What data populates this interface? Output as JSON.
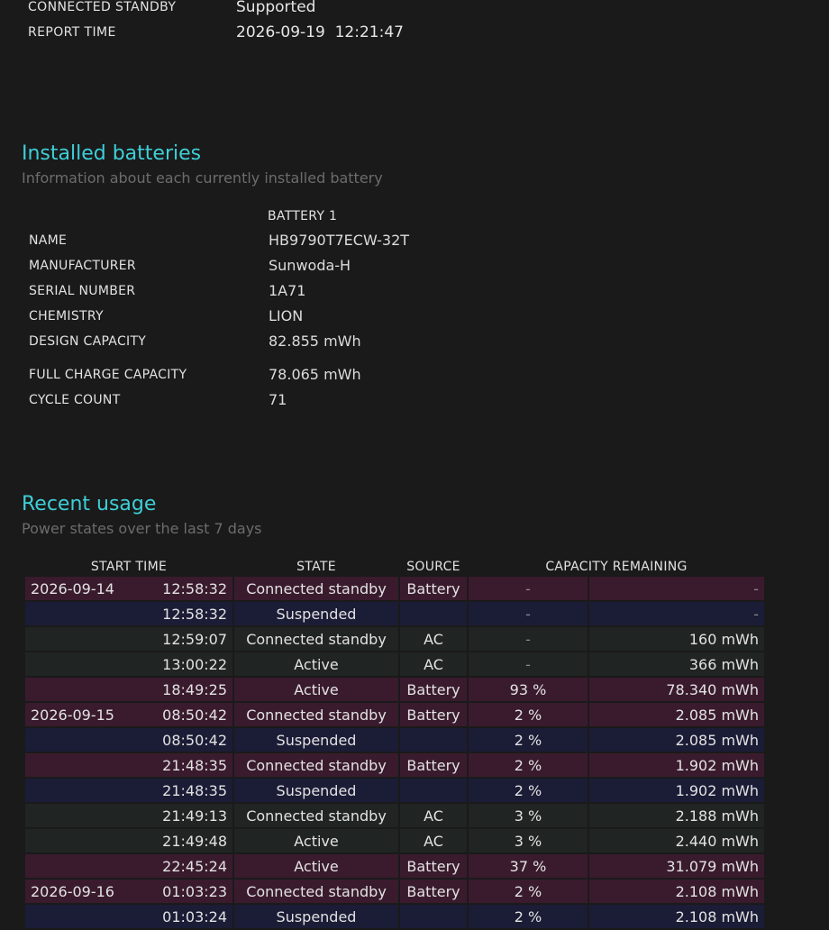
{
  "system": {
    "rows": [
      {
        "label": "CONNECTED STANDBY",
        "value": "Supported"
      },
      {
        "label": "REPORT TIME",
        "value": "2026-09-19  12:21:47"
      }
    ]
  },
  "installed": {
    "title": "Installed batteries",
    "subtitle": "Information about each currently installed battery",
    "column": "BATTERY 1",
    "rows": [
      {
        "label": "NAME",
        "value": "HB9790T7ECW-32T"
      },
      {
        "label": "MANUFACTURER",
        "value": "Sunwoda-H"
      },
      {
        "label": "SERIAL NUMBER",
        "value": "1A71"
      },
      {
        "label": "CHEMISTRY",
        "value": "LION"
      },
      {
        "label": "DESIGN CAPACITY",
        "value": "82.855 mWh"
      },
      {
        "label": "FULL CHARGE CAPACITY",
        "value": "78.065 mWh"
      },
      {
        "label": "CYCLE COUNT",
        "value": "71"
      }
    ]
  },
  "usage": {
    "title": "Recent usage",
    "subtitle": "Power states over the last 7 days",
    "headers": [
      "START TIME",
      "STATE",
      "SOURCE",
      "CAPACITY REMAINING"
    ],
    "rows": [
      {
        "date": "2026-09-14",
        "time": "12:58:32",
        "state": "Connected standby",
        "source": "Battery",
        "pct": "-",
        "mwh": "-",
        "kind": "battery"
      },
      {
        "date": "",
        "time": "12:58:32",
        "state": "Suspended",
        "source": "",
        "pct": "-",
        "mwh": "-",
        "kind": "suspended"
      },
      {
        "date": "",
        "time": "12:59:07",
        "state": "Connected standby",
        "source": "AC",
        "pct": "-",
        "mwh": "160 mWh",
        "kind": "ac"
      },
      {
        "date": "",
        "time": "13:00:22",
        "state": "Active",
        "source": "AC",
        "pct": "-",
        "mwh": "366 mWh",
        "kind": "ac"
      },
      {
        "date": "",
        "time": "18:49:25",
        "state": "Active",
        "source": "Battery",
        "pct": "93 %",
        "mwh": "78.340 mWh",
        "kind": "battery"
      },
      {
        "date": "2026-09-15",
        "time": "08:50:42",
        "state": "Connected standby",
        "source": "Battery",
        "pct": "2 %",
        "mwh": "2.085 mWh",
        "kind": "battery"
      },
      {
        "date": "",
        "time": "08:50:42",
        "state": "Suspended",
        "source": "",
        "pct": "2 %",
        "mwh": "2.085 mWh",
        "kind": "suspended"
      },
      {
        "date": "",
        "time": "21:48:35",
        "state": "Connected standby",
        "source": "Battery",
        "pct": "2 %",
        "mwh": "1.902 mWh",
        "kind": "battery"
      },
      {
        "date": "",
        "time": "21:48:35",
        "state": "Suspended",
        "source": "",
        "pct": "2 %",
        "mwh": "1.902 mWh",
        "kind": "suspended"
      },
      {
        "date": "",
        "time": "21:49:13",
        "state": "Connected standby",
        "source": "AC",
        "pct": "3 %",
        "mwh": "2.188 mWh",
        "kind": "ac"
      },
      {
        "date": "",
        "time": "21:49:48",
        "state": "Active",
        "source": "AC",
        "pct": "3 %",
        "mwh": "2.440 mWh",
        "kind": "ac"
      },
      {
        "date": "",
        "time": "22:45:24",
        "state": "Active",
        "source": "Battery",
        "pct": "37 %",
        "mwh": "31.079 mWh",
        "kind": "battery"
      },
      {
        "date": "2026-09-16",
        "time": "01:03:23",
        "state": "Connected standby",
        "source": "Battery",
        "pct": "2 %",
        "mwh": "2.108 mWh",
        "kind": "battery"
      },
      {
        "date": "",
        "time": "01:03:24",
        "state": "Suspended",
        "source": "",
        "pct": "2 %",
        "mwh": "2.108 mWh",
        "kind": "suspended"
      }
    ]
  }
}
